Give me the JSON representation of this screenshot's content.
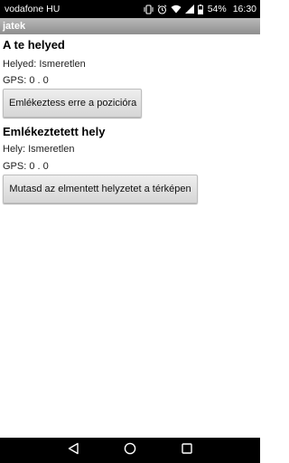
{
  "status_bar": {
    "carrier": "vodafone HU",
    "battery_percent": "54%",
    "time": "16:30",
    "icons": [
      "vibrate-icon",
      "alarm-icon",
      "wifi-icon",
      "signal-icon",
      "battery-icon"
    ]
  },
  "action_bar": {
    "title": "jatek"
  },
  "section_current": {
    "title": "A te helyed",
    "place_line": "Helyed: Ismeretlen",
    "gps_line": "GPS: 0 . 0",
    "button_label": "Emlékeztess erre a pozicióra"
  },
  "section_saved": {
    "title": "Emlékeztetett hely",
    "place_line": "Hely: Ismeretlen",
    "gps_line": "GPS: 0 . 0",
    "button_label": "Mutasd az elmentett helyzetet a térképen"
  },
  "nav_bar": {
    "icons": [
      "back-icon",
      "home-icon",
      "recents-icon"
    ]
  }
}
